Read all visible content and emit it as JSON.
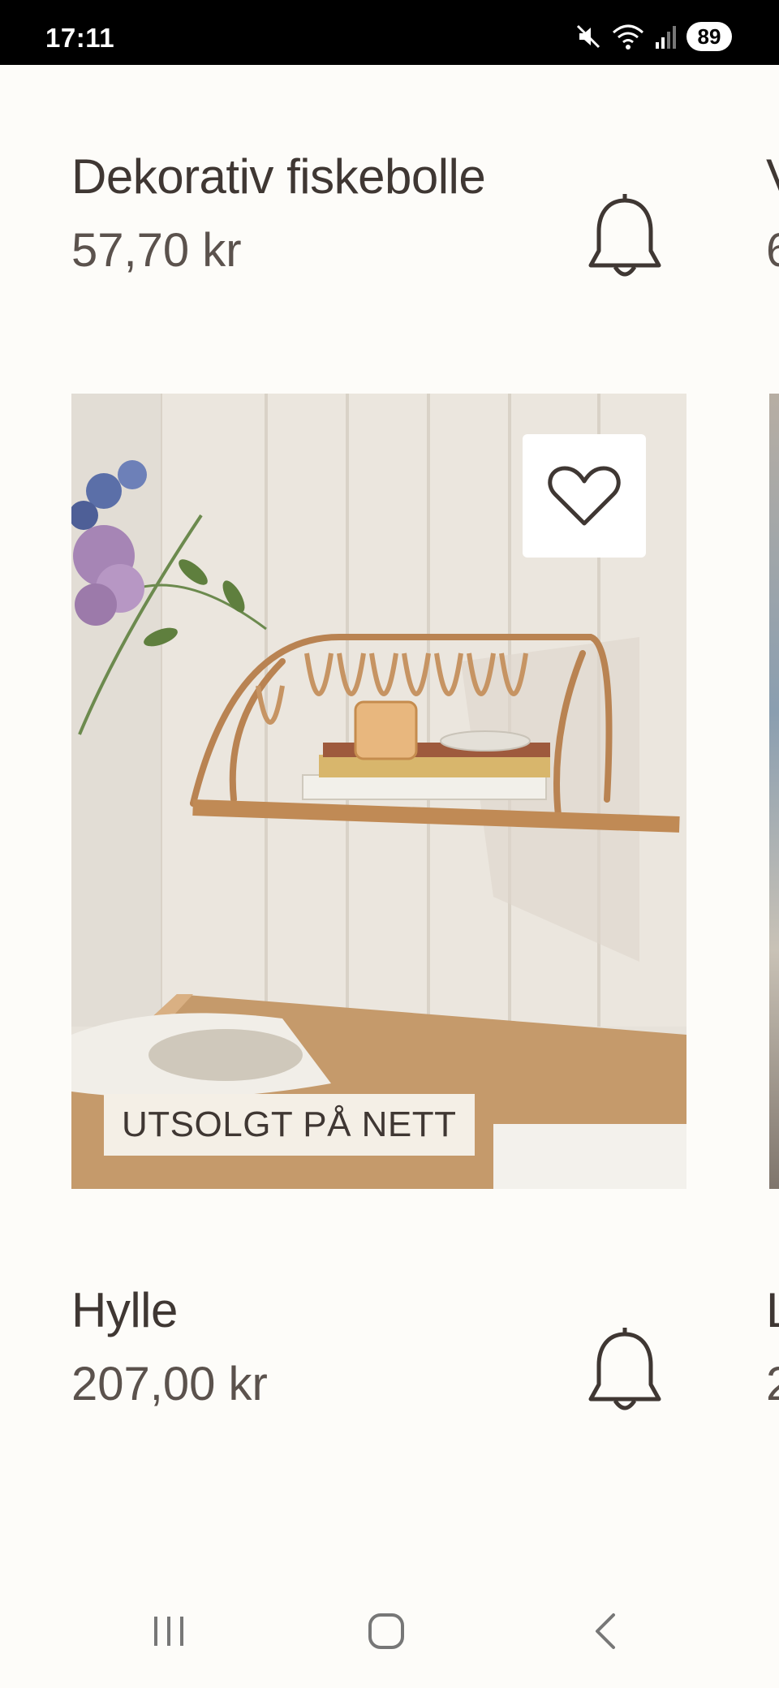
{
  "status_bar": {
    "time": "17:11",
    "battery": "89",
    "icons": [
      "mute-icon",
      "wifi-icon",
      "signal-icon",
      "battery-icon"
    ]
  },
  "products": [
    {
      "title": "Dekorativ fiskebolle",
      "price": "57,70 kr"
    },
    {
      "title": "Hylle",
      "price": "207,00 kr",
      "badge": "UTSOLGT PÅ NETT"
    }
  ],
  "peek": {
    "title1": "V",
    "price1": "6",
    "title2": "L",
    "price2": "2"
  },
  "colors": {
    "text": "#3f3733",
    "background": "#fdfcf9",
    "badge_bg": "#f4efe6"
  },
  "nav": {
    "icons": [
      "recent-apps-icon",
      "home-icon",
      "back-icon"
    ]
  }
}
